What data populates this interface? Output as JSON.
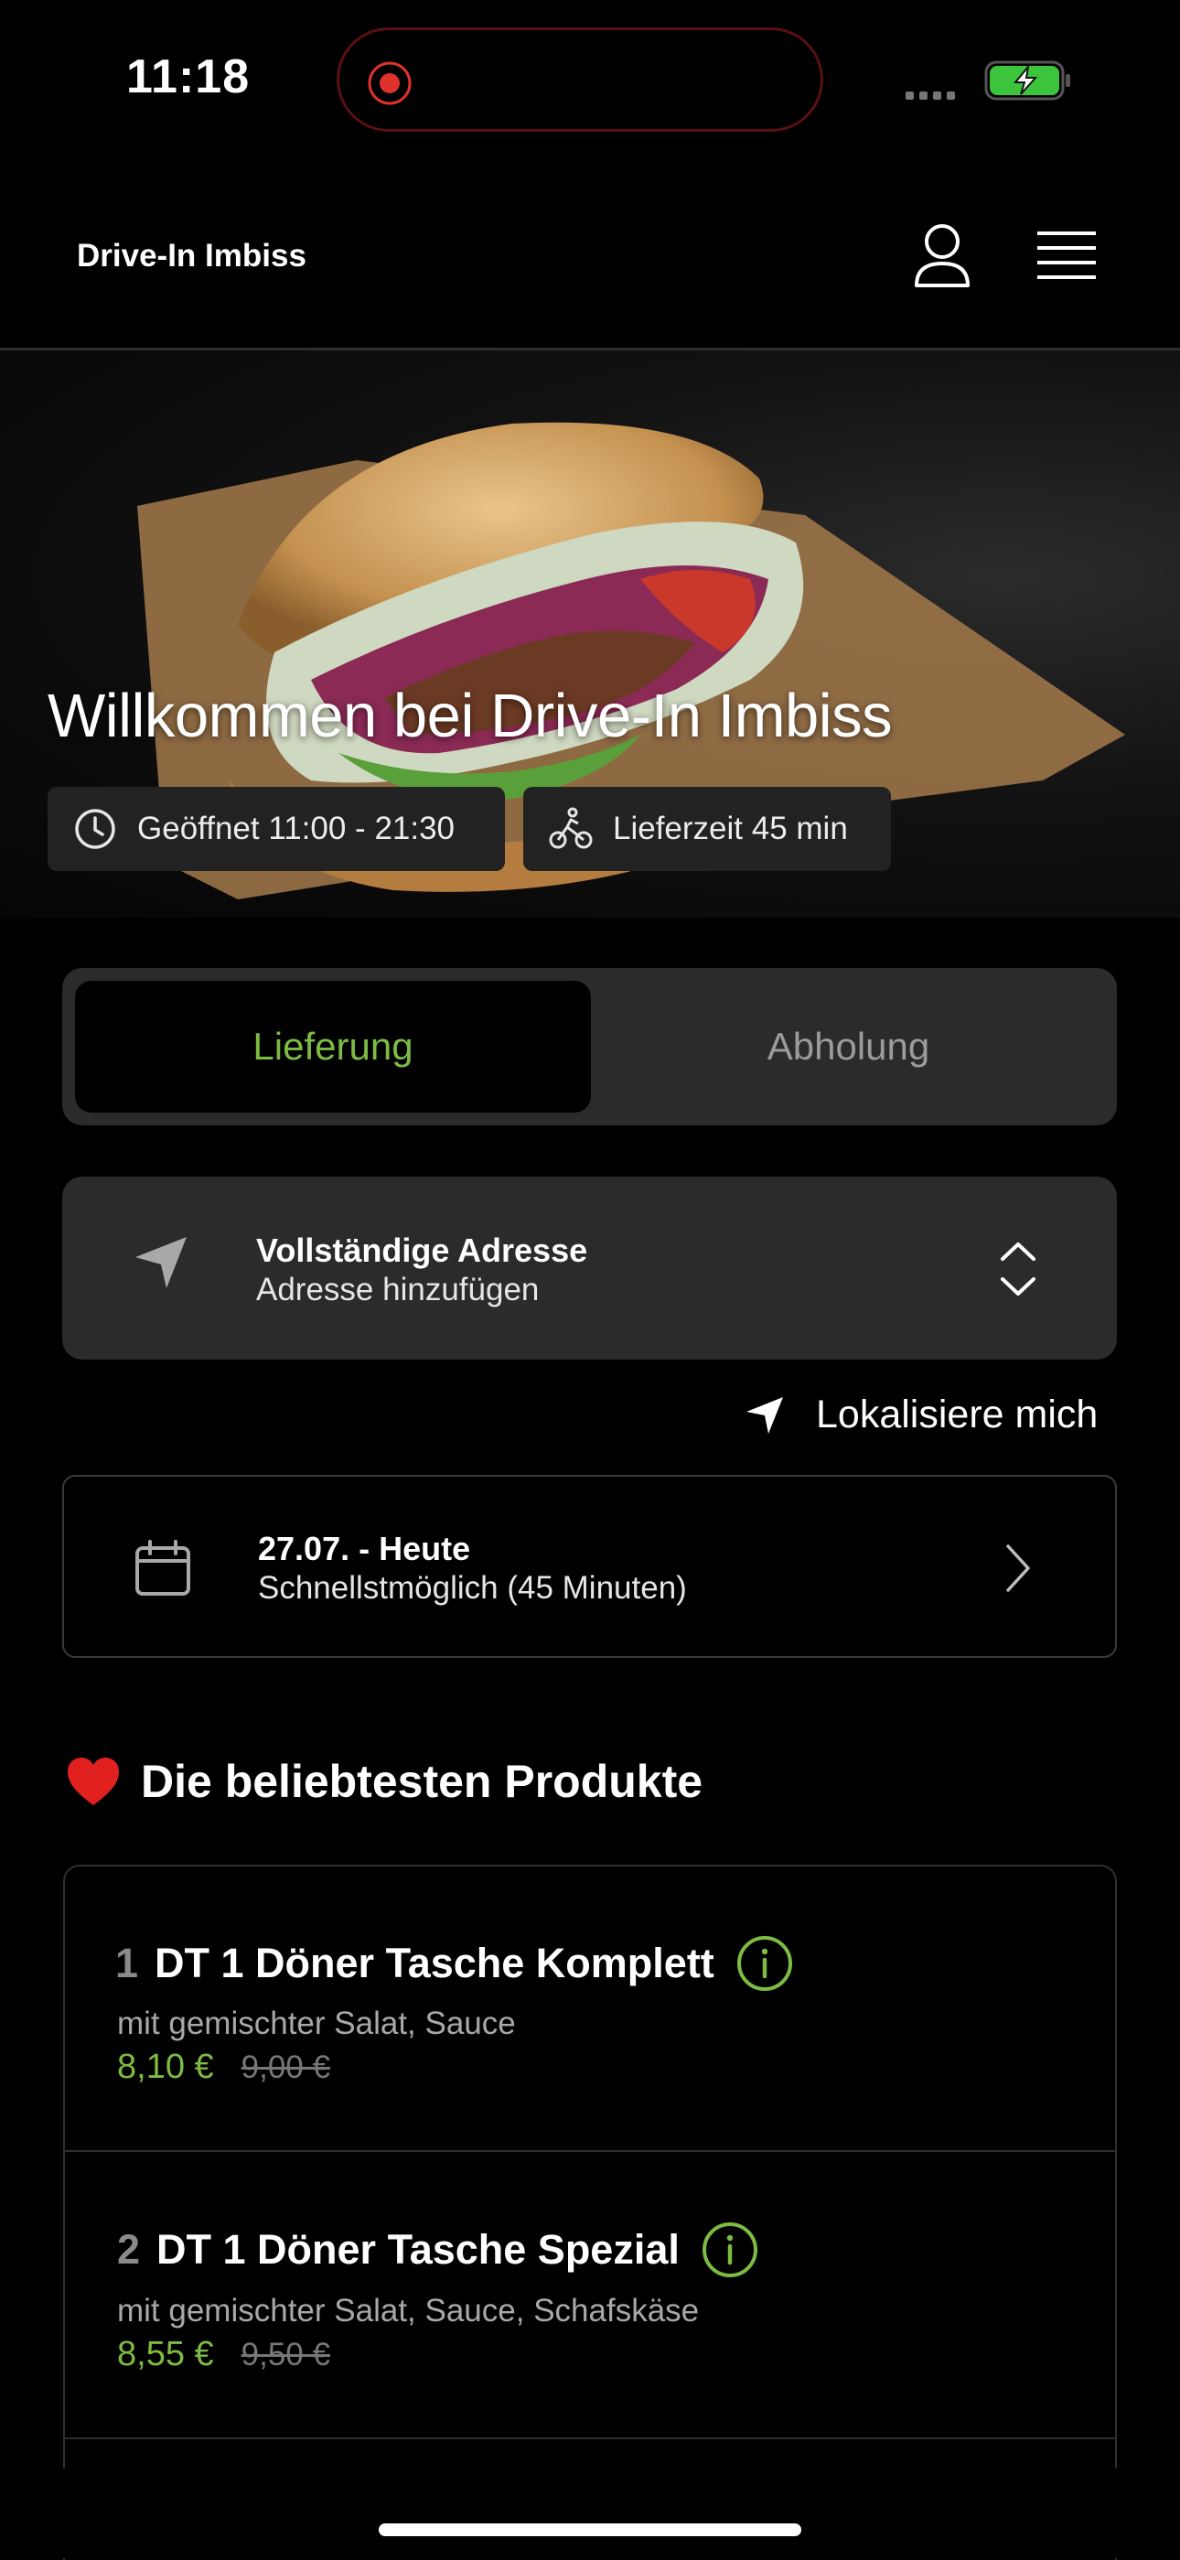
{
  "status_bar": {
    "time": "11:18"
  },
  "header": {
    "brand": "Drive-In Imbiss"
  },
  "hero": {
    "title": "Willkommen bei Drive-In Imbiss",
    "hours": "Geöffnet 11:00 - 21:30",
    "delivery_time": "Lieferzeit 45 min"
  },
  "mode_toggle": {
    "active": "Lieferung",
    "inactive": "Abholung"
  },
  "address": {
    "title": "Vollständige Adresse",
    "subtitle": "Adresse hinzufügen"
  },
  "locate_label": "Lokalisiere mich",
  "schedule": {
    "title": "27.07. - Heute",
    "subtitle": "Schnellstmöglich (45 Minuten)"
  },
  "popular": {
    "title": "Die beliebtesten Produkte",
    "items": [
      {
        "num": "1",
        "name": "DT 1 Döner Tasche Komplett",
        "desc": "mit gemischter Salat, Sauce",
        "price": "8,10 €",
        "old_price": "9,00 €"
      },
      {
        "num": "2",
        "name": "DT 1 Döner Tasche Spezial",
        "desc": "mit gemischter Salat, Sauce, Schafskäse",
        "price": "8,55 €",
        "old_price": "9,50 €"
      }
    ]
  },
  "colors": {
    "accent": "#7dbb42",
    "card": "#2b2b2b",
    "background": "#000000"
  },
  "icons": [
    "user-icon",
    "menu-icon",
    "clock-icon",
    "bike-icon",
    "navigation-arrow-icon",
    "chevron-up-down-icon",
    "calendar-icon",
    "chevron-right-icon",
    "heart-icon",
    "info-icon"
  ]
}
